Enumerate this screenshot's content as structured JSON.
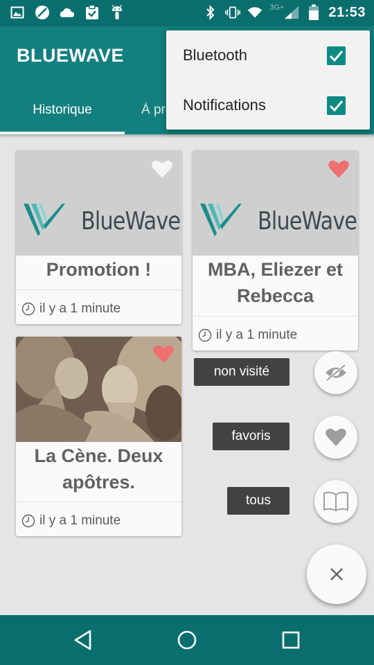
{
  "status_bar": {
    "left_icons": [
      "image-icon",
      "blocked-icon",
      "cloud-icon",
      "clipboard-check-icon",
      "android-icon"
    ],
    "right_icons": [
      "bluetooth-icon",
      "vibrate-icon",
      "wifi-icon",
      "signal-icon",
      "battery-icon"
    ],
    "network_label": "3G+",
    "time": "21:53"
  },
  "app": {
    "title": "BLUEWAVE",
    "tabs": [
      {
        "label": "Historique",
        "active": true
      },
      {
        "label": "À proximité",
        "active": false
      }
    ]
  },
  "cards": [
    {
      "title": "Promotion !",
      "time": "il y a 1 minute",
      "favorite": false,
      "logo_text": "BlueWave"
    },
    {
      "title": "MBA, Eliezer et Rebecca",
      "time": "il y a 1 minute",
      "favorite": true,
      "logo_text": "BlueWave"
    },
    {
      "title": "La Cène. Deux apôtres.",
      "time": "il y a 1 minute",
      "favorite": true
    }
  ],
  "fab_menu": {
    "items": [
      {
        "label": "non visité",
        "icon": "eye-off-icon"
      },
      {
        "label": "favoris",
        "icon": "heart-icon"
      },
      {
        "label": "tous",
        "icon": "book-icon"
      }
    ],
    "main_icon": "close-icon"
  },
  "popup_menu": {
    "items": [
      {
        "label": "Bluetooth",
        "checked": true
      },
      {
        "label": "Notifications",
        "checked": true
      }
    ]
  },
  "nav_bar": {
    "buttons": [
      "back-icon",
      "home-icon",
      "recents-icon"
    ]
  },
  "colors": {
    "primary": "#13807f",
    "primary_dark": "#0b6e6e",
    "favorite": "#ef7070",
    "checkbox": "#0e8a84"
  }
}
